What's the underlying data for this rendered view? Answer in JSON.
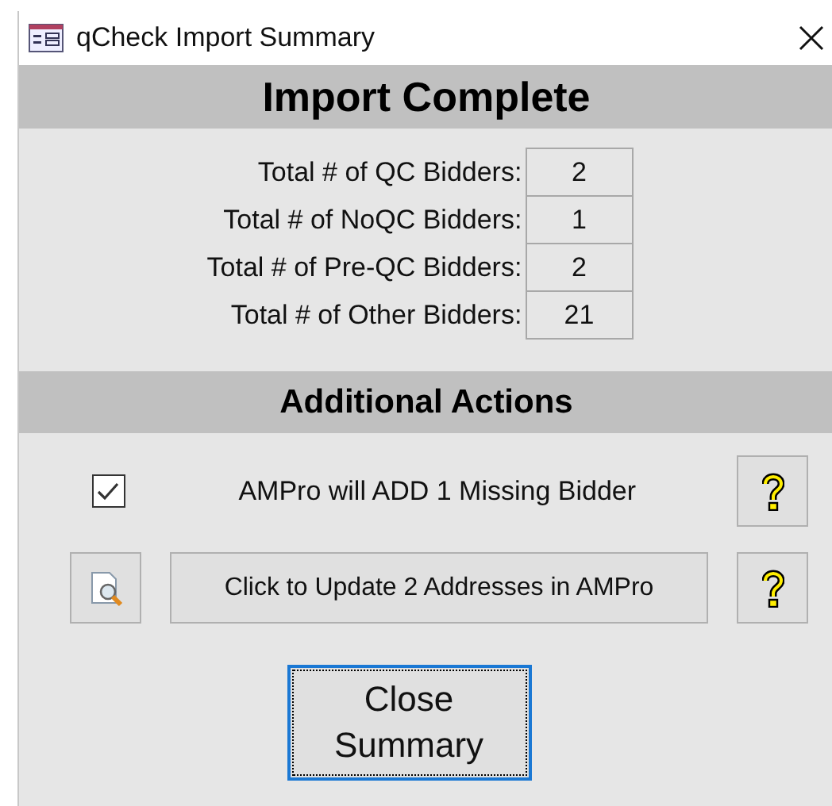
{
  "window": {
    "title": "qCheck Import Summary"
  },
  "heading": "Import Complete",
  "totals": [
    {
      "label": "Total # of QC Bidders:",
      "value": "2"
    },
    {
      "label": "Total # of NoQC Bidders:",
      "value": "1"
    },
    {
      "label": "Total # of Pre-QC Bidders:",
      "value": "2"
    },
    {
      "label": "Total # of Other Bidders:",
      "value": "21"
    }
  ],
  "actions_heading": "Additional Actions",
  "actions": [
    {
      "kind": "checkbox",
      "label": "AMPro will ADD 1 Missing Bidder",
      "checked": true
    },
    {
      "kind": "button",
      "label": "Click to Update 2 Addresses in AMPro"
    }
  ],
  "close_button": {
    "label": "Close Summary",
    "focused": true
  }
}
